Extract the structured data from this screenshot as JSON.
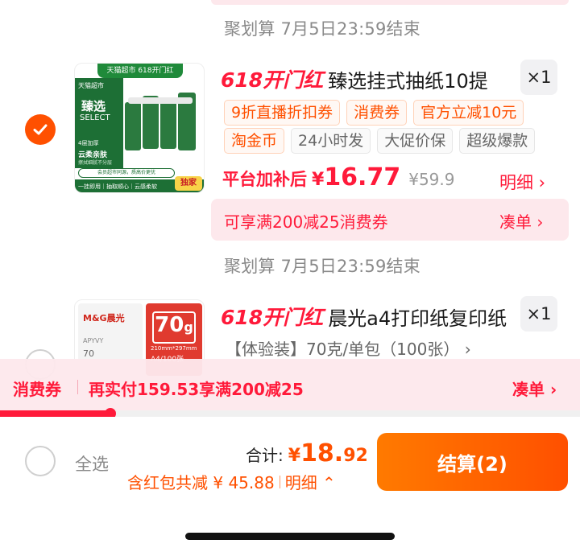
{
  "items": [
    {
      "deadline": "聚划算 7月5日23:59结束",
      "promo": "618开门红",
      "title": "臻选挂式抽纸10提",
      "qty": "×1",
      "tags_orange": [
        "9折直播折扣券",
        "消费券",
        "官方立减10元"
      ],
      "tag_orange_2": "淘金币",
      "tags_gray": [
        "24小时发",
        "大促价保",
        "超级爆款"
      ],
      "price_label": "平台加补后",
      "price_yen": "¥",
      "price_value": "16.77",
      "orig_price": "¥59.9",
      "detail_link": "明细 ›",
      "coupon_text": "可享满200减25消费券",
      "coupon_action": "凑单 ›",
      "thumb": {
        "banner": "天猫超市 618开门红",
        "corner": "天猫超市",
        "brand": "臻选",
        "brand_en": "SELECT",
        "line1": "4层加厚",
        "line2": "云柔亲肤",
        "line3": "擦拭细腻不分层",
        "pill": "会员超市同源，质高价更优",
        "footer": "一挂即用｜抽取顺心｜云感柔软",
        "badge": "独家"
      }
    },
    {
      "deadline": "聚划算 7月5日23:59结束",
      "promo": "618开门红",
      "title": "晨光a4打印纸复印纸",
      "qty": "×1",
      "spec": "【体验装】70克/单包（100张） ›",
      "thumb": {
        "brand": "M&G晨光",
        "num": "70",
        "unit": "g",
        "size": "210mm*297mm",
        "sheets": "A4/100张",
        "code": "APYVY"
      }
    }
  ],
  "floating_bar": {
    "label": "消费券",
    "text": "再实付159.53享满200减25",
    "action": "凑单 ›",
    "progress": 0.19
  },
  "bottom": {
    "select_all": "全选",
    "total_label": "合计:",
    "total_yen": "¥",
    "total_int": "18.",
    "total_dec": "92",
    "discount_text": "含红包共减 ¥ 45.88",
    "detail_text": "明细 ⌃",
    "checkout": "结算(2)"
  },
  "colors": {
    "accent_red": "#ff1a3a",
    "accent_orange": "#ff5000",
    "coupon_bg": "#fde8ec"
  }
}
